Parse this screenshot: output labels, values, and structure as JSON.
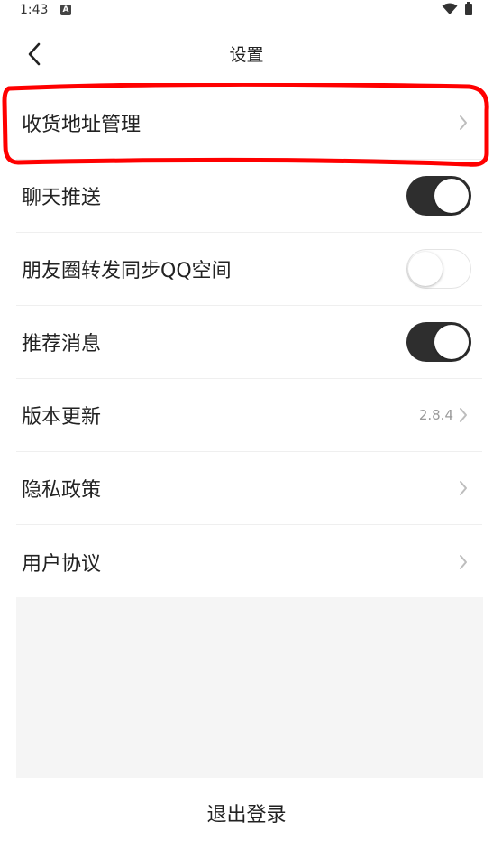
{
  "status_bar": {
    "time": "1:43",
    "notification_icon": "A"
  },
  "header": {
    "title": "设置",
    "back_icon": "chevron-left-icon"
  },
  "settings": {
    "items": [
      {
        "label": "收货地址管理",
        "type": "link"
      },
      {
        "label": "聊天推送",
        "type": "toggle",
        "state": "on"
      },
      {
        "label": "朋友圈转发同步QQ空间",
        "type": "toggle",
        "state": "off"
      },
      {
        "label": "推荐消息",
        "type": "toggle",
        "state": "on"
      },
      {
        "label": "版本更新",
        "type": "link",
        "value": "2.8.4"
      },
      {
        "label": "隐私政策",
        "type": "link"
      },
      {
        "label": "用户协议",
        "type": "link"
      }
    ]
  },
  "logout_label": "退出登录",
  "colors": {
    "toggle_on": "#2e2e2e",
    "annotation": "#ff0000",
    "panel": "#f5f5f5"
  }
}
